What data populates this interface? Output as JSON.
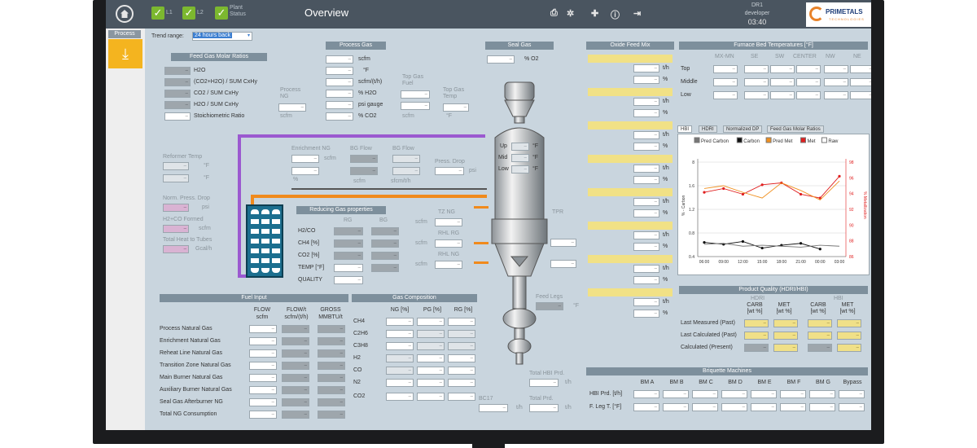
{
  "topbar": {
    "title": "Overview",
    "checks": [
      {
        "label": "L1",
        "icon": "check-icon"
      },
      {
        "label": "L2",
        "icon": "check-icon"
      },
      {
        "label": "Plant Status",
        "icon": "check-icon"
      }
    ],
    "user_line1": "DR1",
    "user_line2": "developer",
    "time": "03:40",
    "brand": "PRIMETALS",
    "brand_sub": "TECHNOLOGIES"
  },
  "nav": {
    "section": "Process",
    "button_icon": "process-icon"
  },
  "trend": {
    "label": "Trend range:",
    "value": "24 hours back"
  },
  "feed_ratios": {
    "title": "Feed Gas Molar Ratios",
    "rows": [
      "H2O",
      "(CO2+H2O) / SUM CxHy",
      "CO2 / SUM CxHy",
      "H2O / SUM CxHy",
      "Stoichiometric Ratio"
    ]
  },
  "process_gas": {
    "title": "Process Gas",
    "units": [
      "scfm",
      "°F",
      "scfm/(t/h)",
      "% H2O",
      "psi gauge",
      "% CO2"
    ]
  },
  "process_ng": {
    "label1": "Process",
    "label2": "NG",
    "unit": "scfm"
  },
  "top_gas_fuel": {
    "label1": "Top Gas",
    "label2": "Fuel",
    "unit": "scfm"
  },
  "top_gas_temp": {
    "label1": "Top Gas",
    "label2": "Temp",
    "unit": "°F"
  },
  "seal_gas": {
    "title": "Seal Gas",
    "unit": "% O2"
  },
  "reformer": {
    "temp_label": "Reformer Temp",
    "unit_f": "°F",
    "dp_label": "Norm. Press. Drop",
    "dp_unit": "psi",
    "h2co_label": "H2+CO Formed",
    "h2co_unit": "scfm",
    "heat_label": "Total Heat to Tubes",
    "heat_unit": "Gcal/h"
  },
  "enrichment": {
    "label": "Enrichment NG",
    "unit": "scfm",
    "pct": "%"
  },
  "bg_flow": {
    "label": "BG Flow",
    "unit1": "scfm",
    "unit2": "sfcm/t/h"
  },
  "press_drop": {
    "label": "Press. Drop",
    "unit": "psi"
  },
  "reducing_gas": {
    "title": "Reducing Gas properties",
    "col_rg": "RG",
    "col_bg": "BG",
    "rows": [
      "H2/CO",
      "CH4 [%]",
      "CO2 [%]",
      "TEMP [°F]",
      "QUALITY"
    ]
  },
  "shaft": {
    "up": "Up",
    "mid": "Mid",
    "low": "Low",
    "unit": "°F"
  },
  "right_flows": {
    "tz": "TZ NG",
    "rhl_rg": "RHL RG",
    "rhl_ng": "RHL NG",
    "tpr": "TPR",
    "scfm": "scfm"
  },
  "feed_legs": {
    "label": "Feed Legs",
    "unit": "°F"
  },
  "fuel_input": {
    "title": "Fuel Input",
    "cols": [
      "FLOW\nscfm",
      "FLOW/t\nscfm/(t/h)",
      "GROSS\nMMBTU/t"
    ],
    "rows": [
      "Process Natural Gas",
      "Enrichment Natural Gas",
      "Reheat Line Natural Gas",
      "Transition Zone Natural Gas",
      "Main Burner Natural Gas",
      "Auxiliary Burner Natural Gas",
      "Seal Gas Afterburner NG",
      "Total NG Consumption"
    ]
  },
  "gas_comp": {
    "title": "Gas Composition",
    "cols": [
      "NG [%]",
      "PG [%]",
      "RG [%]"
    ],
    "rows": [
      "CH4",
      "C2H6",
      "C3H8",
      "H2",
      "CO",
      "N2",
      "CO2"
    ]
  },
  "hbi_prod": {
    "total_hbi": "Total HBI Prd.",
    "bc17": "BC17",
    "total": "Total Prd.",
    "unit": "t/h"
  },
  "oxide_feed": {
    "title": "Oxide Feed Mix",
    "units": [
      "t/h",
      "%"
    ]
  },
  "furnace": {
    "title": "Furnace Bed Temperatures [°F]",
    "cols": [
      "MX-MN",
      "SE",
      "SW",
      "CENTER",
      "NW",
      "NE"
    ],
    "rows": [
      "Top",
      "Middle",
      "Low"
    ]
  },
  "chart_tabs": [
    "HBI",
    "HDRI",
    "Normalized DP",
    "Feed Gas Molar Ratios"
  ],
  "chart_data": {
    "type": "line",
    "legend": [
      "Pred Carbon",
      "Carbon",
      "Pred Met",
      "Met",
      "Raw"
    ],
    "x": [
      "06:00",
      "09:00",
      "12:00",
      "15:00",
      "18:00",
      "21:00",
      "00:00",
      "03:00"
    ],
    "left_ylabel": "% - Carbon",
    "right_ylabel": "% Metallization",
    "left_ticks": [
      "8",
      "1.6",
      "1.2",
      "0.8",
      "0.4"
    ],
    "right_ticks": [
      "98",
      "96",
      "94",
      "92",
      "90",
      "88",
      "86"
    ],
    "series": [
      {
        "name": "Met",
        "color": "#e02020",
        "values": [
          0.68,
          0.72,
          0.66,
          0.76,
          0.78,
          0.66,
          0.62,
          0.85
        ]
      },
      {
        "name": "Pred Met",
        "color": "#f09020",
        "values": [
          0.72,
          0.75,
          0.68,
          0.62,
          0.78,
          0.7,
          0.6,
          0.8
        ]
      },
      {
        "name": "Carbon",
        "color": "#111111",
        "values": [
          0.15,
          0.13,
          0.16,
          0.09,
          0.12,
          0.14,
          0.08,
          null
        ]
      },
      {
        "name": "Pred Carbon",
        "color": "#777777",
        "values": [
          0.13,
          0.14,
          0.11,
          0.12,
          0.11,
          0.1,
          0.12,
          0.11
        ]
      }
    ]
  },
  "product_quality": {
    "title": "Product Quality (HDRI/HBI)",
    "group1": "HDRI",
    "group2": "HBI",
    "cols": [
      "CARB\n[wt %]",
      "MET\n[wt %]",
      "CARB\n[wt %]",
      "MET\n[wt %]"
    ],
    "rows": [
      "Last Measured (Past)",
      "Last Calculated (Past)",
      "Calculated (Present)"
    ]
  },
  "briquette": {
    "title": "Briquette Machines",
    "cols": [
      "BM A",
      "BM B",
      "BM C",
      "BM D",
      "BM E",
      "BM F",
      "BM G",
      "Bypass"
    ],
    "rows": [
      "HBI Prd. [t/h]",
      "F. Leg T. [°F]"
    ]
  },
  "colors": {
    "accent": "#f4b41f",
    "check": "#7cb82f",
    "header": "#7d8f9c",
    "pipe_purple": "#9b59d0",
    "pipe_orange": "#f08a1c"
  }
}
